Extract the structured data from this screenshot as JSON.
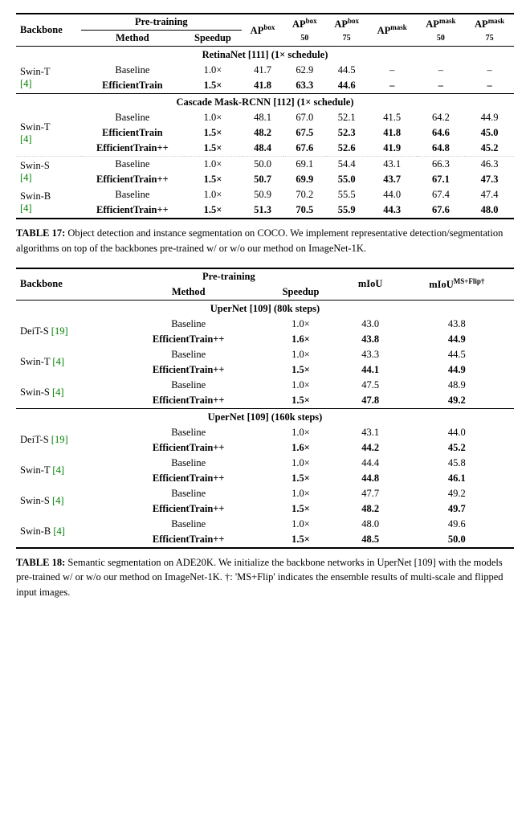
{
  "table1": {
    "headers": {
      "backbone": "Backbone",
      "pretrain": "Pre-training",
      "method": "Method",
      "speedup": "Speedup",
      "ap_box": "AP",
      "ap_box_50": "AP",
      "ap_box_75": "AP",
      "ap_mask": "AP",
      "ap_mask_50": "AP",
      "ap_mask_75": "AP",
      "ap_box_sup": "box",
      "ap_box_50_sup": "box",
      "ap_box_75_sup": "box",
      "ap_mask_sup": "mask",
      "ap_mask_50_sup": "mask",
      "ap_mask_75_sup": "mask",
      "ap_box_sub": "",
      "ap_box_50_sub": "50",
      "ap_box_75_sub": "75",
      "ap_mask_sub": "",
      "ap_mask_50_sub": "50",
      "ap_mask_75_sub": "75"
    },
    "retina_header": "RetinaNet [111] (1× schedule)",
    "cascade_header": "Cascade Mask-RCNN [112] (1× schedule)",
    "rows": [
      {
        "backbone": "Swin-T",
        "backbone_ref": "[4]",
        "method": "Baseline",
        "speedup": "1.0×",
        "ap_box": "41.7",
        "ap_box_50": "62.9",
        "ap_box_75": "44.5",
        "ap_mask": "–",
        "ap_mask_50": "–",
        "ap_mask_75": "–",
        "bold": false,
        "section": "retina"
      },
      {
        "backbone": "",
        "backbone_ref": "",
        "method": "EfficientTrain",
        "speedup": "1.5×",
        "ap_box": "41.8",
        "ap_box_50": "63.3",
        "ap_box_75": "44.6",
        "ap_mask": "–",
        "ap_mask_50": "–",
        "ap_mask_75": "–",
        "bold": true,
        "section": "retina"
      },
      {
        "backbone": "Swin-T",
        "backbone_ref": "[4]",
        "method": "Baseline",
        "speedup": "1.0×",
        "ap_box": "48.1",
        "ap_box_50": "67.0",
        "ap_box_75": "52.1",
        "ap_mask": "41.5",
        "ap_mask_50": "64.2",
        "ap_mask_75": "44.9",
        "bold": false,
        "section": "cascade"
      },
      {
        "backbone": "",
        "backbone_ref": "",
        "method": "EfficientTrain",
        "speedup": "1.5×",
        "ap_box": "48.2",
        "ap_box_50": "67.5",
        "ap_box_75": "52.3",
        "ap_mask": "41.8",
        "ap_mask_50": "64.6",
        "ap_mask_75": "45.0",
        "bold": true,
        "section": "cascade"
      },
      {
        "backbone": "",
        "backbone_ref": "",
        "method": "EfficientTrain++",
        "speedup": "1.5×",
        "ap_box": "48.4",
        "ap_box_50": "67.6",
        "ap_box_75": "52.6",
        "ap_mask": "41.9",
        "ap_mask_50": "64.8",
        "ap_mask_75": "45.2",
        "bold": true,
        "bold_vals": [
          "48.4",
          "41.9"
        ],
        "section": "cascade"
      },
      {
        "backbone": "Swin-S",
        "backbone_ref": "[4]",
        "method": "Baseline",
        "speedup": "1.0×",
        "ap_box": "50.0",
        "ap_box_50": "69.1",
        "ap_box_75": "54.4",
        "ap_mask": "43.1",
        "ap_mask_50": "66.3",
        "ap_mask_75": "46.3",
        "bold": false,
        "section": "cascade"
      },
      {
        "backbone": "",
        "backbone_ref": "",
        "method": "EfficientTrain++",
        "speedup": "1.5×",
        "ap_box": "50.7",
        "ap_box_50": "69.9",
        "ap_box_75": "55.0",
        "ap_mask": "43.7",
        "ap_mask_50": "67.1",
        "ap_mask_75": "47.3",
        "bold": true,
        "bold_vals": [
          "50.7",
          "43.7"
        ],
        "section": "cascade"
      },
      {
        "backbone": "Swin-B",
        "backbone_ref": "[4]",
        "method": "Baseline",
        "speedup": "1.0×",
        "ap_box": "50.9",
        "ap_box_50": "70.2",
        "ap_box_75": "55.5",
        "ap_mask": "44.0",
        "ap_mask_50": "67.4",
        "ap_mask_75": "47.4",
        "bold": false,
        "section": "cascade"
      },
      {
        "backbone": "",
        "backbone_ref": "",
        "method": "EfficientTrain++",
        "speedup": "1.5×",
        "ap_box": "51.3",
        "ap_box_50": "70.5",
        "ap_box_75": "55.9",
        "ap_mask": "44.3",
        "ap_mask_50": "67.6",
        "ap_mask_75": "48.0",
        "bold": true,
        "bold_vals": [
          "51.3",
          "44.3"
        ],
        "section": "cascade"
      }
    ],
    "caption_num": "TABLE 17:",
    "caption_text": " Object detection and instance segmentation on COCO. We implement representative detection/segmentation algorithms on top of the backbones pre-trained w/ or w/o our method on ImageNet-1K."
  },
  "table2": {
    "headers": {
      "backbone": "Backbone",
      "pretrain": "Pre-training",
      "method": "Method",
      "speedup": "Speedup",
      "miou": "mIoU",
      "miou_ms": "mIoU"
    },
    "miou_ms_sup": "MS+Flip†",
    "upernet_80k_header": "UperNet [109] (80k steps)",
    "upernet_160k_header": "UperNet [109] (160k steps)",
    "rows_80k": [
      {
        "backbone": "DeiT-S [19]",
        "method": "Baseline",
        "speedup": "1.0×",
        "miou": "43.0",
        "miou_ms": "43.8",
        "bold": false
      },
      {
        "backbone": "",
        "method": "EfficientTrain++",
        "speedup": "1.6×",
        "miou": "43.8",
        "miou_ms": "44.9",
        "bold": true,
        "bold_vals": [
          "43.8",
          "44.9"
        ]
      },
      {
        "backbone": "Swin-T [4]",
        "method": "Baseline",
        "speedup": "1.0×",
        "miou": "43.3",
        "miou_ms": "44.5",
        "bold": false
      },
      {
        "backbone": "",
        "method": "EfficientTrain++",
        "speedup": "1.5×",
        "miou": "44.1",
        "miou_ms": "44.9",
        "bold": true,
        "bold_vals": [
          "44.1",
          "44.9"
        ]
      },
      {
        "backbone": "Swin-S [4]",
        "method": "Baseline",
        "speedup": "1.0×",
        "miou": "47.5",
        "miou_ms": "48.9",
        "bold": false
      },
      {
        "backbone": "",
        "method": "EfficientTrain++",
        "speedup": "1.5×",
        "miou": "47.8",
        "miou_ms": "49.2",
        "bold": true,
        "bold_vals": [
          "47.8",
          "49.2"
        ]
      }
    ],
    "rows_160k": [
      {
        "backbone": "DeiT-S [19]",
        "method": "Baseline",
        "speedup": "1.0×",
        "miou": "43.1",
        "miou_ms": "44.0",
        "bold": false
      },
      {
        "backbone": "",
        "method": "EfficientTrain++",
        "speedup": "1.6×",
        "miou": "44.2",
        "miou_ms": "45.2",
        "bold": true,
        "bold_vals": [
          "44.2",
          "45.2"
        ]
      },
      {
        "backbone": "Swin-T [4]",
        "method": "Baseline",
        "speedup": "1.0×",
        "miou": "44.4",
        "miou_ms": "45.8",
        "bold": false
      },
      {
        "backbone": "",
        "method": "EfficientTrain++",
        "speedup": "1.5×",
        "miou": "44.8",
        "miou_ms": "46.1",
        "bold": true,
        "bold_vals": [
          "44.8",
          "46.1"
        ]
      },
      {
        "backbone": "Swin-S [4]",
        "method": "Baseline",
        "speedup": "1.0×",
        "miou": "47.7",
        "miou_ms": "49.2",
        "bold": false
      },
      {
        "backbone": "",
        "method": "EfficientTrain++",
        "speedup": "1.5×",
        "miou": "48.2",
        "miou_ms": "49.7",
        "bold": true,
        "bold_vals": [
          "48.2",
          "49.7"
        ]
      },
      {
        "backbone": "Swin-B [4]",
        "method": "Baseline",
        "speedup": "1.0×",
        "miou": "48.0",
        "miou_ms": "49.6",
        "bold": false
      },
      {
        "backbone": "",
        "method": "EfficientTrain++",
        "speedup": "1.5×",
        "miou": "48.5",
        "miou_ms": "50.0",
        "bold": true,
        "bold_vals": [
          "48.5",
          "50.0"
        ]
      }
    ],
    "caption_num": "TABLE 18:",
    "caption_text": " Semantic segmentation on ADE20K. We initialize the backbone networks in UperNet [109] with the models pre-trained w/ or w/o our method on ImageNet-1K. †: 'MS+Flip' indicates the ensemble results of multi-scale and flipped input images."
  }
}
